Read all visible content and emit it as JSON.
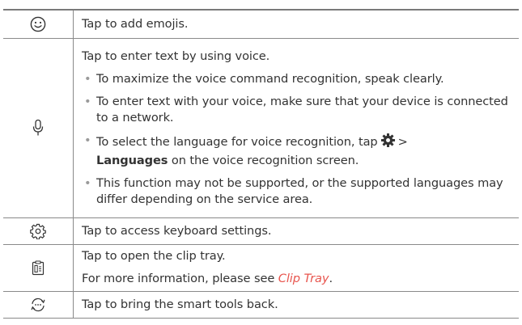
{
  "rows": [
    {
      "icon": "emoji-icon",
      "text": "Tap to add emojis."
    },
    {
      "icon": "microphone-icon",
      "text": "Tap to enter text by using voice.",
      "bullets": [
        {
          "text": "To maximize the voice command recognition, speak clearly."
        },
        {
          "text": "To enter text with your voice, make sure that your device is connected to a network."
        },
        {
          "pre": "To select the language for voice recognition, tap",
          "icon": "gear-icon",
          "post": ">",
          "bold": "Languages",
          "tail": "on the voice recognition screen."
        },
        {
          "text": "This function may not be supported, or the supported languages may differ depending on the service area."
        }
      ]
    },
    {
      "icon": "settings-icon",
      "text": "Tap to access keyboard settings."
    },
    {
      "icon": "clip-tray-icon",
      "text": "Tap to open the clip tray.",
      "more_pre": "For more information, please see",
      "more_link": "Clip Tray",
      "more_post": "."
    },
    {
      "icon": "smart-tools-icon",
      "text": "Tap to bring the smart tools back."
    }
  ],
  "bullet_char": "•"
}
